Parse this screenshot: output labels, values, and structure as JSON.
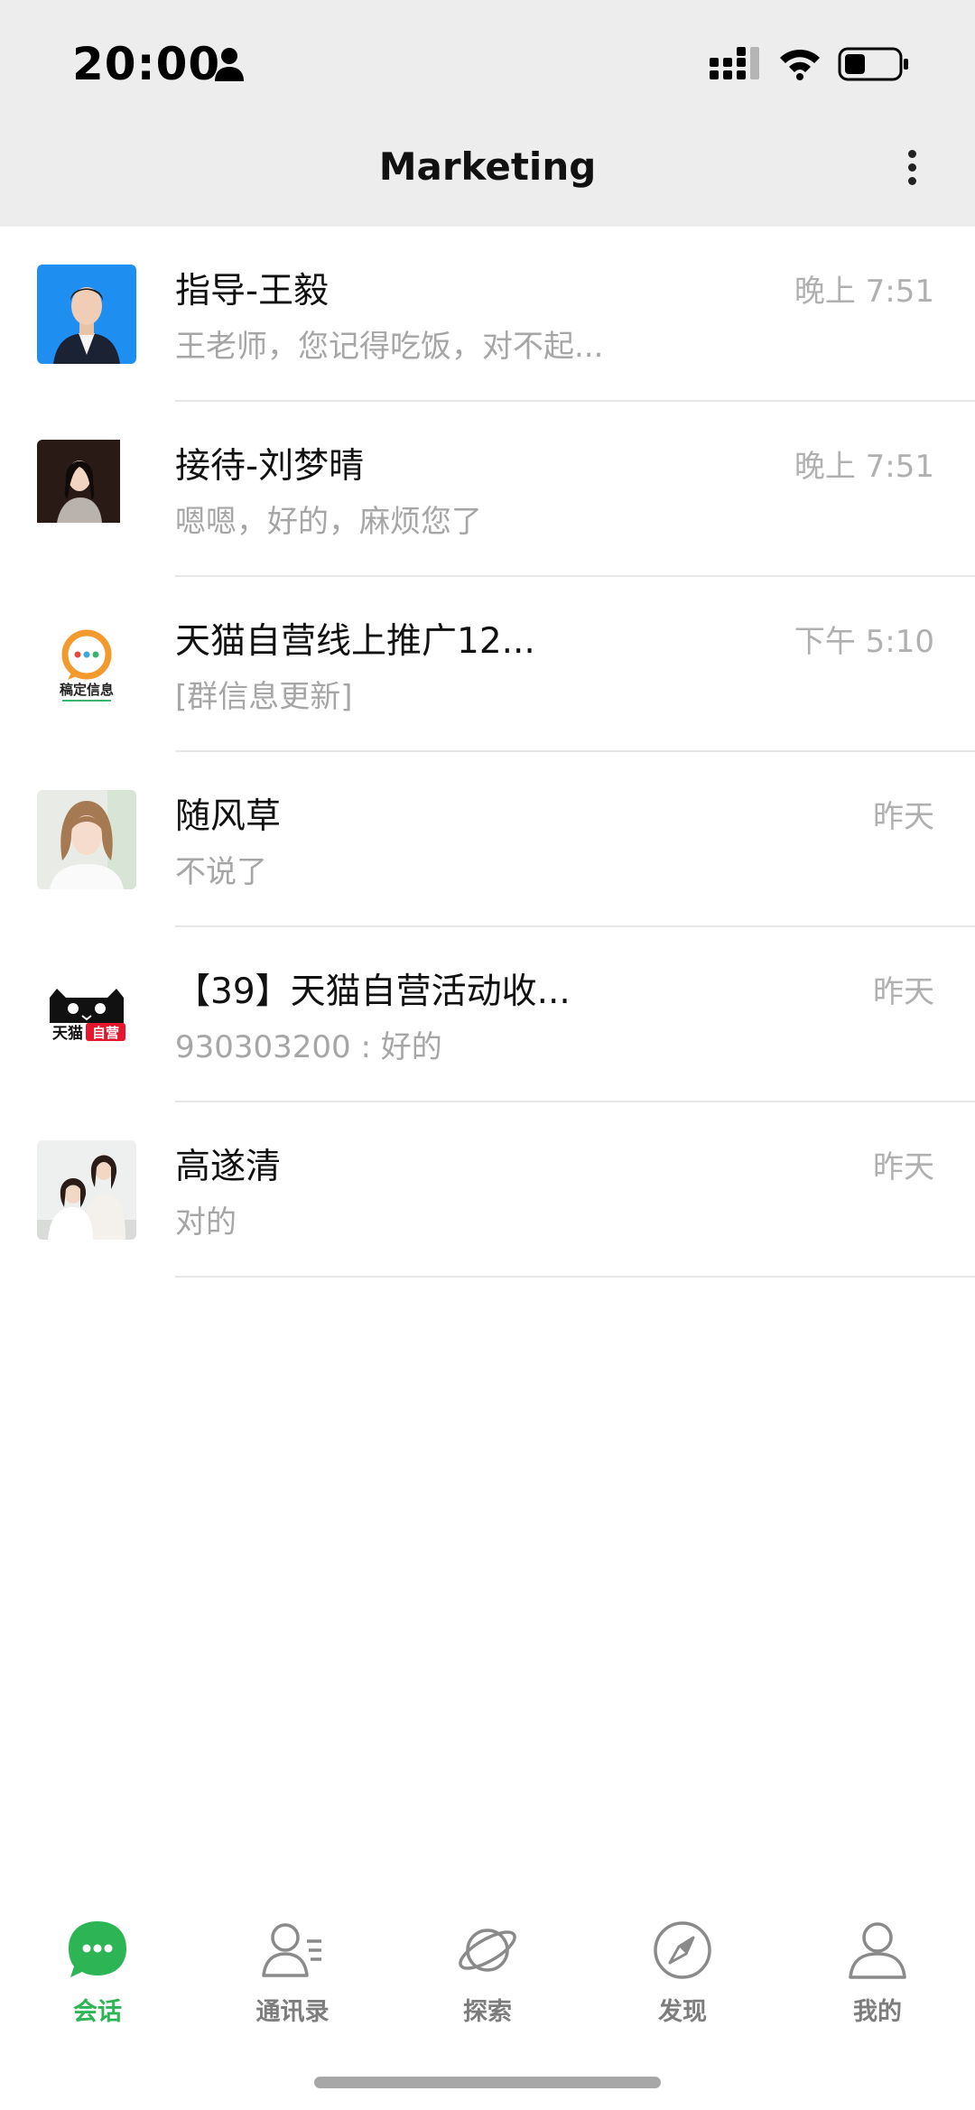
{
  "status_bar": {
    "time": "20:00"
  },
  "header": {
    "title": "Marketing"
  },
  "chats": [
    {
      "name": "指导-王毅",
      "preview": "王老师，您记得吃饭，对不起...",
      "time": "晚上 7:51",
      "avatar": "person-blue-background-avatar"
    },
    {
      "name": "接待-刘梦晴",
      "preview": "嗯嗯，好的，麻烦您了",
      "time": "晚上 7:51",
      "avatar": "person-dark-background-avatar"
    },
    {
      "name": "天猫自营线上推广12...",
      "preview": "[群信息更新]",
      "time": "下午 5:10",
      "avatar": "group-logo-avatar",
      "logo_text": "稿定信息"
    },
    {
      "name": "随风草",
      "preview": "不说了",
      "time": "昨天",
      "avatar": "woman-portrait-avatar"
    },
    {
      "name": "【39】天猫自营活动收...",
      "preview": "930303200 : 好的",
      "time": "昨天",
      "avatar": "tmall-logo-avatar",
      "logo_text": "天猫自营"
    },
    {
      "name": "高遂清",
      "preview": "对的",
      "time": "昨天",
      "avatar": "two-women-avatar"
    }
  ],
  "tabs": [
    {
      "label": "会话",
      "icon": "chat-bubble-icon",
      "active": true
    },
    {
      "label": "通讯录",
      "icon": "contacts-icon",
      "active": false
    },
    {
      "label": "探索",
      "icon": "planet-icon",
      "active": false
    },
    {
      "label": "发现",
      "icon": "compass-icon",
      "active": false
    },
    {
      "label": "我的",
      "icon": "profile-icon",
      "active": false
    }
  ],
  "colors": {
    "accent_green": "#2db455",
    "header_bg": "#ededed",
    "preview_text": "#a6a6a6"
  }
}
